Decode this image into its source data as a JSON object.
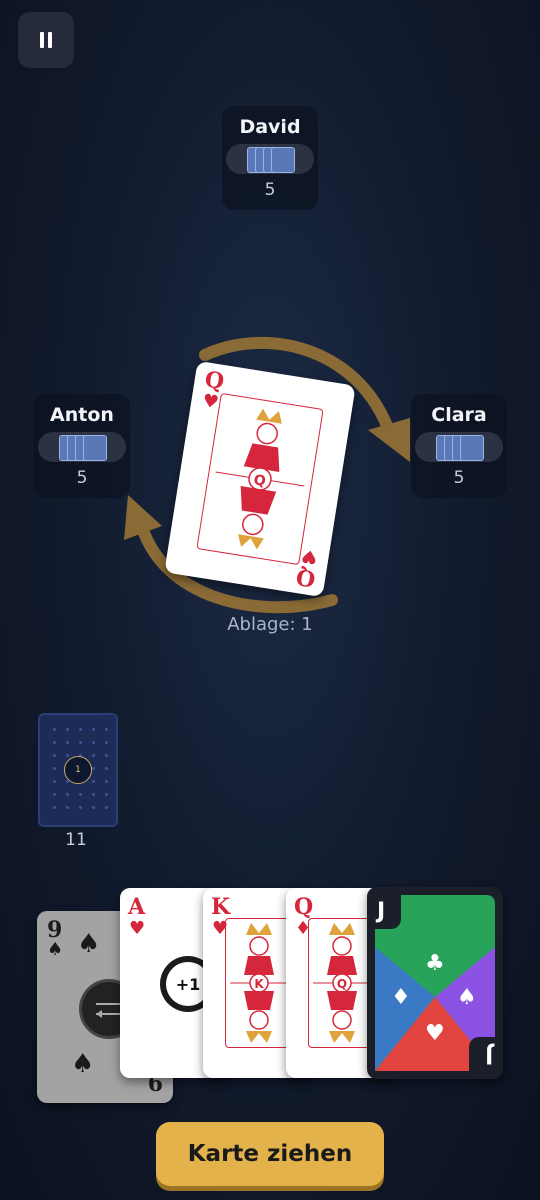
{
  "pause_icon": "pause-icon",
  "players": [
    {
      "id": "top",
      "name": "David",
      "card_count": "5"
    },
    {
      "id": "left",
      "name": "Anton",
      "card_count": "5"
    },
    {
      "id": "right",
      "name": "Clara",
      "card_count": "5"
    }
  ],
  "direction_indicator": {
    "icon": "clockwise-arrows-icon",
    "color": "#8a6a35"
  },
  "discard_top": {
    "rank": "Q",
    "suit": "hearts",
    "suit_symbol": "♥",
    "color": "#d6263b"
  },
  "discard_label": "Ablage: 1",
  "deck": {
    "badge": "1",
    "count": "11"
  },
  "hand": [
    {
      "rank": "9",
      "suit_symbol": "♠",
      "bottom_rank": "6",
      "badge": "reverse-icon",
      "dimmed": true
    },
    {
      "rank": "A",
      "suit_symbol": "♥",
      "badge_text": "+1"
    },
    {
      "rank": "K",
      "suit_symbol": "♥",
      "center_letter": "K"
    },
    {
      "rank": "Q",
      "suit_symbol": "♦",
      "center_letter": "Q"
    },
    {
      "rank": "J",
      "suit_symbols": [
        "♣",
        "♦",
        "♠",
        "♥"
      ],
      "wild": true,
      "colors": [
        "#27a35a",
        "#3a79c4",
        "#8b52e3",
        "#e2453f"
      ]
    }
  ],
  "draw_button_label": "Karte ziehen"
}
